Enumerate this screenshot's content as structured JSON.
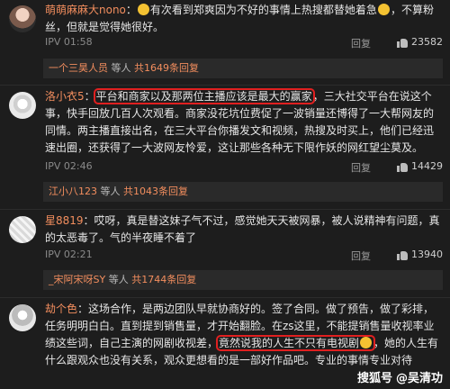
{
  "comments": [
    {
      "username": "萌萌麻麻大nono",
      "text_after_name": "有次看到郑爽因为不好的事情上热搜都替她着急",
      "text_after_emoji": "，不算粉丝，但就是觉得她很好。",
      "time": "IPV 01:58",
      "reply_label": "回复",
      "likes": "23582",
      "sub": {
        "who": "一个三昊人员",
        "mid": " 等人 ",
        "count": "共1649条回复"
      }
    },
    {
      "username": "洛小衣5",
      "highlight": "平台和商家以及那两位主播应该是最大的赢家",
      "text_rest": "三大社交平台在说这个事，快手回放几百人次观看。商家没花坑位费促了一波销量还博得了一大帮网友的同情。两主播直接出名，在三大平台你播发文和视频，热搜及时买上，他们已经迅速出圈，还获得了一大波网友怜爱，这让那些各种无下限作妖的网红望尘莫及。",
      "time": "IPV 02:46",
      "reply_label": "回复",
      "likes": "14429",
      "sub": {
        "who": "江小八123",
        "mid": " 等人 ",
        "count": "共1043条回复"
      }
    },
    {
      "username": "星8819",
      "text": "：哎呀，真是替这妹子气不过，感觉她天天被网暴，被人说精神有问题，真的太恶毒了。气的半夜睡不着了",
      "time": "IPV 02:21",
      "reply_label": "回复",
      "likes": "13940",
      "sub": {
        "who": "_宋阿宋呀SY",
        "mid": " 等人 ",
        "count": "共1744条回复"
      }
    },
    {
      "username": "劫个色",
      "text_before": "：这场合作，是两边团队早就协商好的。签了合同。做了预告，做了彩排，任务明明白白。直到提到销售量，才开始翻脸。在zs这里，不能提销售量收视率业绩这些词，自己主演的网剧收视差，",
      "highlight": "竟然说我的人生不只有电视剧",
      "text_after": "，她的人生有什么跟观众也没有关系，观众更想看的是一部好作品吧。专业的事情专业对待"
    }
  ],
  "watermark": {
    "brand": "搜狐号",
    "author": "@吴清功"
  },
  "colors": {
    "background": "#1d1d1d",
    "username": "#f38e5e",
    "highlight_box": "#e02020"
  }
}
